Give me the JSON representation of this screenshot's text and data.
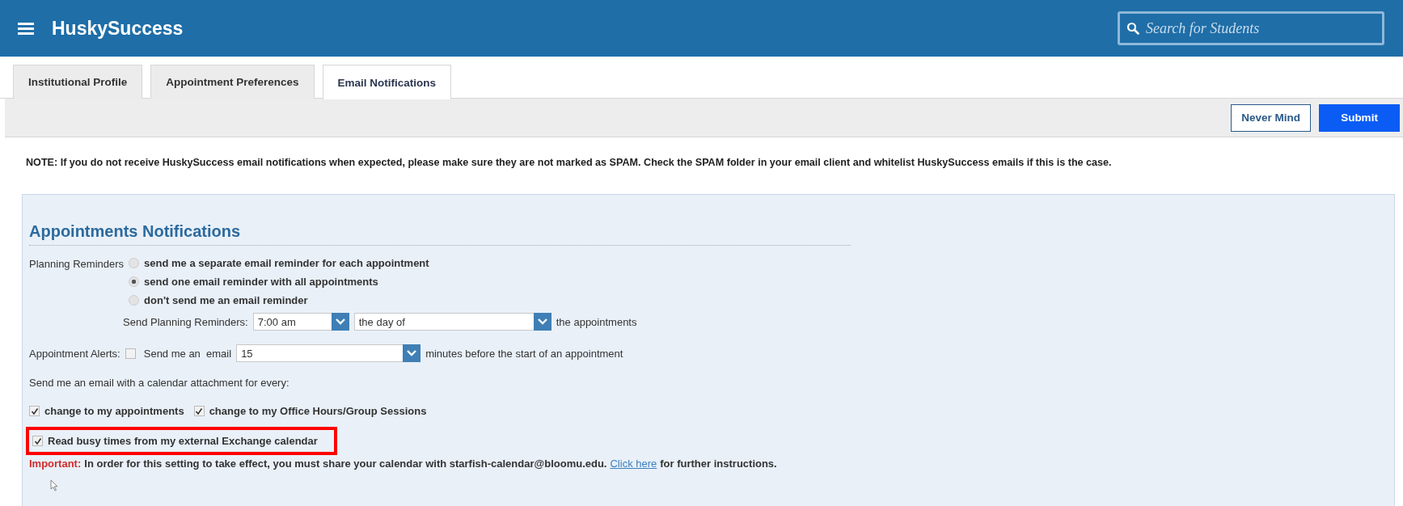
{
  "header": {
    "title": "HuskySuccess",
    "search": {
      "placeholder": "Search for Students"
    }
  },
  "tabs": [
    {
      "label": "Institutional Profile",
      "selected": false
    },
    {
      "label": "Appointment Preferences",
      "selected": false
    },
    {
      "label": "Email Notifications",
      "selected": true
    }
  ],
  "toolbar": {
    "buttons": [
      {
        "label": "Never Mind",
        "kind": "secondary"
      },
      {
        "label": "Submit",
        "kind": "primary"
      }
    ]
  },
  "note": "NOTE: If you do not receive HuskySuccess email notifications when expected, please make sure they are not marked as SPAM. Check the SPAM folder in your email client and whitelist HuskySuccess emails if this is the case.",
  "section": {
    "heading": "Appointments Notifications",
    "planning": {
      "label": "Planning Reminders",
      "options": [
        {
          "label": "send me a separate email reminder for each appointment",
          "selected": false
        },
        {
          "label": "send one email reminder with all appointments",
          "selected": true
        },
        {
          "label": "don't send me an email reminder",
          "selected": false
        }
      ],
      "send_label": "Send Planning Reminders:",
      "time": "7:00 am",
      "day": "the day of",
      "suffix": "the appointments"
    },
    "alerts": {
      "label": "Appointment Alerts:",
      "checked": false,
      "send_label": "Send me an  email",
      "minutes": "15",
      "suffix": "minutes before the start of an appointment"
    },
    "calendar_intro": "Send me an email with a calendar attachment for every:",
    "calendar_options": [
      {
        "label": "change to my appointments",
        "checked": true
      },
      {
        "label": "change to my Office Hours/Group Sessions",
        "checked": true
      }
    ],
    "exchange": {
      "label": "Read busy times from my external Exchange calendar",
      "checked": true,
      "highlighted": true
    },
    "important": {
      "label": "Important:",
      "text": "In order for this setting to take effect, you must share your calendar with starfish-calendar@bloomu.edu.",
      "link": "Click here",
      "after": "for further instructions."
    }
  }
}
